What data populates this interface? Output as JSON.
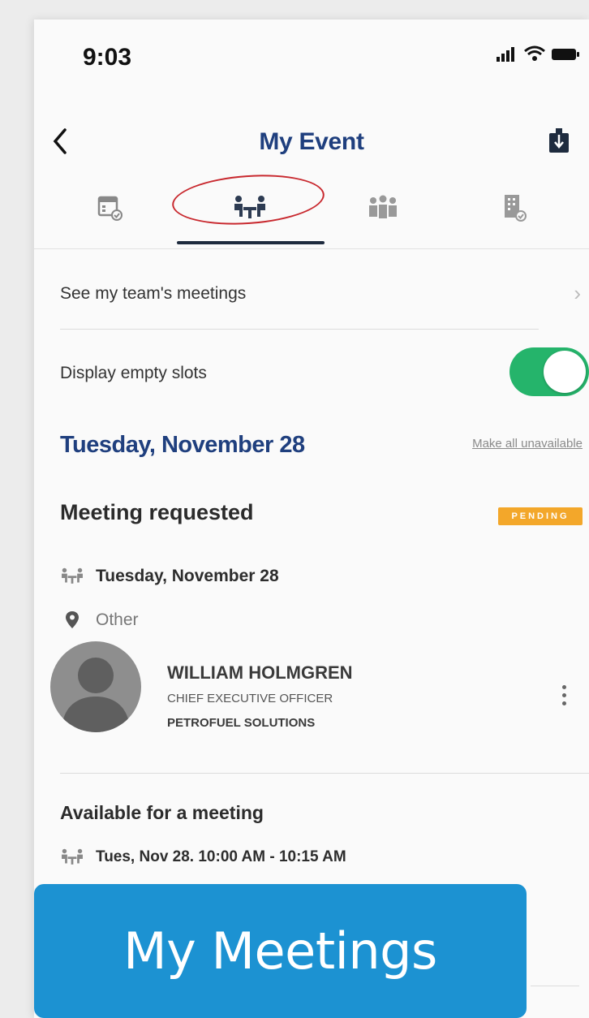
{
  "status_bar": {
    "time": "9:03"
  },
  "nav": {
    "title": "My Event"
  },
  "tabs": [
    {
      "icon": "calendar-check-icon"
    },
    {
      "icon": "meeting-table-icon",
      "selected": true
    },
    {
      "icon": "people-group-icon"
    },
    {
      "icon": "building-check-icon"
    }
  ],
  "team_meetings": {
    "label": "See my team's meetings"
  },
  "empty_slots": {
    "label": "Display empty slots",
    "enabled": true
  },
  "day": {
    "heading": "Tuesday, November 28",
    "make_unavailable": "Make all unavailable"
  },
  "meeting_requested": {
    "title": "Meeting requested",
    "badge": "PENDING",
    "date": "Tuesday, November 28",
    "location": "Other",
    "contact": {
      "name": "WILLIAM HOLMGREN",
      "role": "CHIEF EXECUTIVE OFFICER",
      "company": "PETROFUEL SOLUTIONS"
    }
  },
  "available": {
    "title": "Available for a meeting",
    "slot": "Tues, Nov 28. 10:00 AM - 10:15 AM"
  },
  "caption": "My Meetings",
  "colors": {
    "brand_blue": "#1f3f7e",
    "toggle_green": "#25b46b",
    "pending_orange": "#f3a72a",
    "caption_blue": "#1c92d2"
  }
}
